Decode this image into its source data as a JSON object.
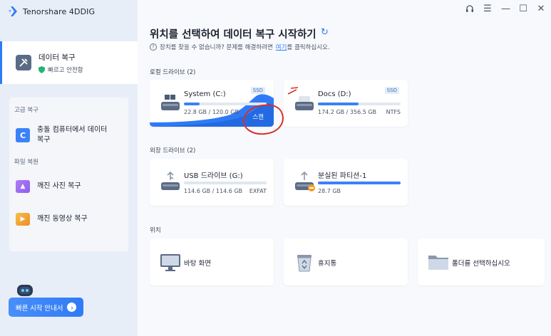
{
  "app": {
    "name": "Tenorshare 4DDIG"
  },
  "colors": {
    "accent": "#2f7bf6",
    "sidebar_bg": "#e8eef8",
    "scan_annotation": "#d6312a"
  },
  "sidebar": {
    "active_item": {
      "label": "데이터 복구",
      "sub": "빠르고 안전함",
      "icon": "tools-icon"
    },
    "sections": [
      {
        "label": "고급 복구",
        "items": [
          {
            "label": "충돌 컴퓨터에서 데이터 복구",
            "icon": "crashed-pc-icon"
          }
        ]
      },
      {
        "label": "파일 복원",
        "items": [
          {
            "label": "깨진 사진 복구",
            "icon": "photo-icon"
          },
          {
            "label": "깨진 동영상 복구",
            "icon": "video-icon"
          }
        ]
      }
    ],
    "quick_start": "빠른 시작 안내서"
  },
  "window_controls": [
    "headset-icon",
    "menu-icon",
    "minimize-icon",
    "maximize-icon",
    "close-icon"
  ],
  "main": {
    "title": "위치를 선택하여 데이터 복구 시작하기",
    "help": {
      "text": "장치를 찾을 수 없습니까? 문제를 해결하려면",
      "link": "여기",
      "suffix": "를 클릭하십시오."
    },
    "local_drives_label": "로컬 드라이브 (2)",
    "external_drives_label": "외장 드라이브 (2)",
    "locations_label": "위치",
    "local_drives": [
      {
        "name": "System (C:)",
        "size": "22.8 GB / 120.0 GB",
        "fs": "",
        "badge": "SSD",
        "used_fraction": 0.19,
        "scan_label": "스캔",
        "hover": true
      },
      {
        "name": "Docs (D:)",
        "size": "174.2 GB / 356.5 GB",
        "fs": "NTFS",
        "badge": "SSD",
        "used_fraction": 0.49
      }
    ],
    "external_drives": [
      {
        "name": "USB 드라이브 (G:)",
        "size": "114.6 GB / 114.6 GB",
        "fs": "EXFAT",
        "used_fraction": 1.0,
        "icon": "usb-drive-icon"
      },
      {
        "name": "분실된 파티션-1",
        "size": "28.7 GB",
        "fs": "",
        "used_fraction": 1.0,
        "icon": "lost-partition-icon"
      }
    ],
    "locations": [
      {
        "name": "바탕 화면",
        "icon": "desktop-icon"
      },
      {
        "name": "휴지통",
        "icon": "recycle-bin-icon"
      },
      {
        "name": "폴더를 선택하십시오",
        "icon": "folder-icon"
      }
    ]
  }
}
